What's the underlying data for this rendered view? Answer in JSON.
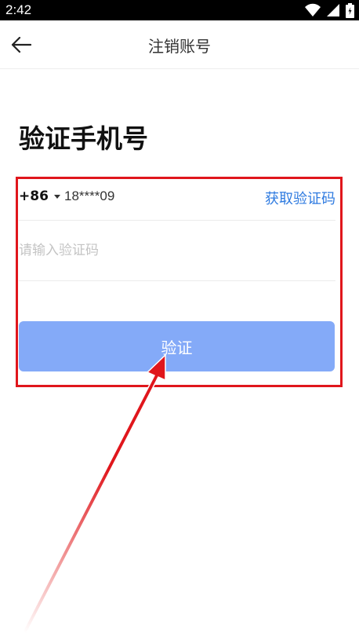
{
  "status_bar": {
    "time": "2:42",
    "icons": [
      "wifi-icon",
      "cellular-signal-icon",
      "battery-icon"
    ]
  },
  "nav": {
    "title": "注销账号",
    "back_icon": "back-arrow-icon"
  },
  "heading": "验证手机号",
  "form": {
    "country_code": "+86",
    "phone_number": "18****09",
    "get_code_label": "获取验证码",
    "code_placeholder": "请输入验证码",
    "code_value": "",
    "verify_label": "验证"
  },
  "colors": {
    "accent_link": "#2f7be0",
    "button_bg": "#84aaf8",
    "annotation_red": "#e0161c"
  }
}
